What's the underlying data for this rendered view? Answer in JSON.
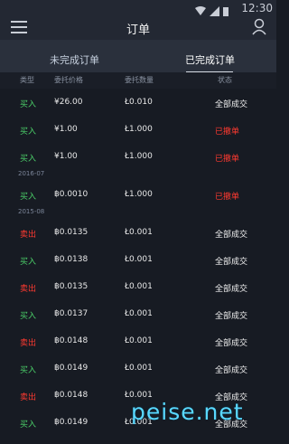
{
  "status": {
    "time": "12:30"
  },
  "header": {
    "title": "订单"
  },
  "tabs": [
    {
      "label": "未完成订单"
    },
    {
      "label": "已完成订单"
    }
  ],
  "columns": [
    "类型",
    "委托价格",
    "委托数量",
    "状态"
  ],
  "groups": [
    {
      "month": "",
      "rows": [
        {
          "type": "买入",
          "price": "¥26.00",
          "qty": "Ł0.010",
          "status": "全部成交"
        },
        {
          "type": "买入",
          "price": "¥1.00",
          "qty": "Ł1.000",
          "status": "已撤单"
        },
        {
          "type": "买入",
          "price": "¥1.00",
          "qty": "Ł1.000",
          "status": "已撤单"
        }
      ]
    },
    {
      "month": "2016-07",
      "rows": [
        {
          "type": "买入",
          "price": "฿0.0010",
          "qty": "Ł1.000",
          "status": "已撤单"
        }
      ]
    },
    {
      "month": "2015-08",
      "rows": [
        {
          "type": "卖出",
          "price": "฿0.0135",
          "qty": "Ł0.001",
          "status": "全部成交"
        },
        {
          "type": "买入",
          "price": "฿0.0138",
          "qty": "Ł0.001",
          "status": "全部成交"
        },
        {
          "type": "卖出",
          "price": "฿0.0135",
          "qty": "Ł0.001",
          "status": "全部成交"
        },
        {
          "type": "买入",
          "price": "฿0.0137",
          "qty": "Ł0.001",
          "status": "全部成交"
        },
        {
          "type": "卖出",
          "price": "฿0.0148",
          "qty": "Ł0.001",
          "status": "全部成交"
        },
        {
          "type": "买入",
          "price": "฿0.0149",
          "qty": "Ł0.001",
          "status": "全部成交"
        },
        {
          "type": "卖出",
          "price": "฿0.0148",
          "qty": "Ł0.001",
          "status": "全部成交"
        },
        {
          "type": "买入",
          "price": "฿0.0149",
          "qty": "Ł0.001",
          "status": "全部成交"
        }
      ]
    }
  ],
  "watermark": "peise.net"
}
